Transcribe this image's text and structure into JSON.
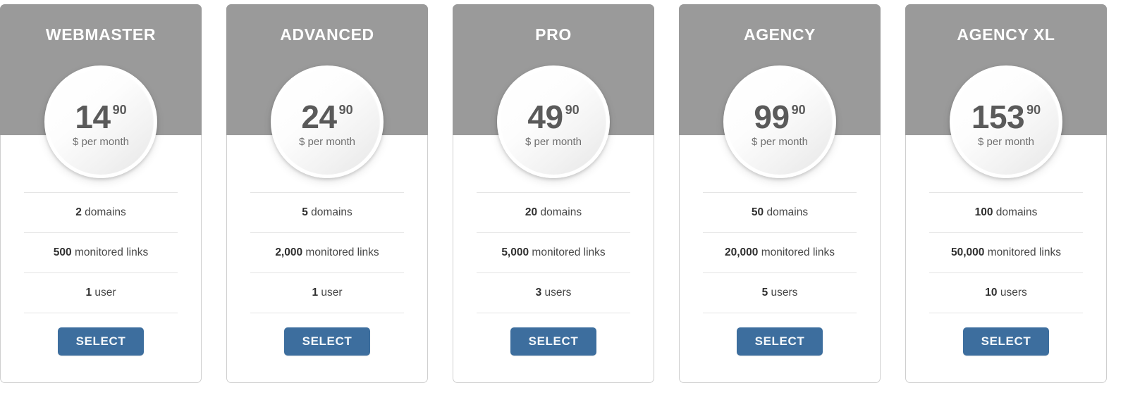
{
  "table": {
    "select_label": "SELECT",
    "period_label": "$ per month",
    "colors": {
      "header_gray": "#9a9a9a",
      "button_blue": "#3d6e9e",
      "card_border": "#cfcfcf",
      "divider": "#e4e4e4",
      "price_text": "#5a5a5a"
    }
  },
  "plans": [
    {
      "name": "WEBMASTER",
      "price_whole": "14",
      "price_cents": "90",
      "period": "$ per month",
      "features": [
        {
          "value": "2",
          "label": "domains"
        },
        {
          "value": "500",
          "label": "monitored links"
        },
        {
          "value": "1",
          "label": "user"
        }
      ],
      "select_label": "SELECT"
    },
    {
      "name": "ADVANCED",
      "price_whole": "24",
      "price_cents": "90",
      "period": "$ per month",
      "features": [
        {
          "value": "5",
          "label": "domains"
        },
        {
          "value": "2,000",
          "label": "monitored links"
        },
        {
          "value": "1",
          "label": "user"
        }
      ],
      "select_label": "SELECT"
    },
    {
      "name": "PRO",
      "price_whole": "49",
      "price_cents": "90",
      "period": "$ per month",
      "features": [
        {
          "value": "20",
          "label": "domains"
        },
        {
          "value": "5,000",
          "label": "monitored links"
        },
        {
          "value": "3",
          "label": "users"
        }
      ],
      "select_label": "SELECT"
    },
    {
      "name": "AGENCY",
      "price_whole": "99",
      "price_cents": "90",
      "period": "$ per month",
      "features": [
        {
          "value": "50",
          "label": "domains"
        },
        {
          "value": "20,000",
          "label": "monitored links"
        },
        {
          "value": "5",
          "label": "users"
        }
      ],
      "select_label": "SELECT"
    },
    {
      "name": "AGENCY XL",
      "price_whole": "153",
      "price_cents": "90",
      "period": "$ per month",
      "features": [
        {
          "value": "100",
          "label": "domains"
        },
        {
          "value": "50,000",
          "label": "monitored links"
        },
        {
          "value": "10",
          "label": "users"
        }
      ],
      "select_label": "SELECT"
    }
  ]
}
